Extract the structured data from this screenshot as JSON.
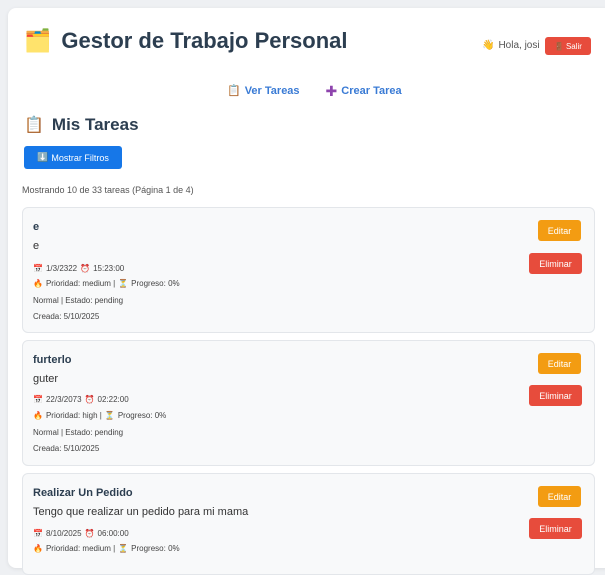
{
  "header": {
    "title": "Gestor de Trabajo Personal",
    "icon": "folder-icon"
  },
  "user": {
    "greeting": "Hola, josi",
    "logout_label": "Salir"
  },
  "nav": {
    "view_tasks": "Ver Tareas",
    "create_task": "Crear Tarea"
  },
  "section": {
    "title": "Mis Tareas"
  },
  "filters": {
    "label": "Mostrar Filtros"
  },
  "pagination": {
    "summary": "Mostrando 10 de 33 tareas (Página 1 de 4)"
  },
  "tasks": [
    {
      "name": "e",
      "description": "e",
      "date": "1/3/2322",
      "time": "15:23:00",
      "priority": "Prioridad: medium |",
      "progress": "Progreso: 0%",
      "status": "Normal | Estado: pending",
      "created": "Creada: 5/10/2025"
    },
    {
      "name": "furterlo",
      "description": "guter",
      "date": "22/3/2073",
      "time": "02:22:00",
      "priority": "Prioridad: high |",
      "progress": "Progreso: 0%",
      "status": "Normal | Estado: pending",
      "created": "Creada: 5/10/2025"
    },
    {
      "name": "Realizar Un Pedido",
      "description": "Tengo que realizar un pedido para mi mama",
      "date": "8/10/2025",
      "time": "06:00:00",
      "priority": "Prioridad: medium |",
      "progress": "Progreso: 0%",
      "status": "",
      "created": ""
    }
  ],
  "actions": {
    "edit_label": "Editar",
    "delete_label": "Eliminar"
  },
  "colors": {
    "primary": "#1677e8",
    "danger": "#e74c3c",
    "warning": "#f39c12",
    "link": "#3a7bd5"
  }
}
